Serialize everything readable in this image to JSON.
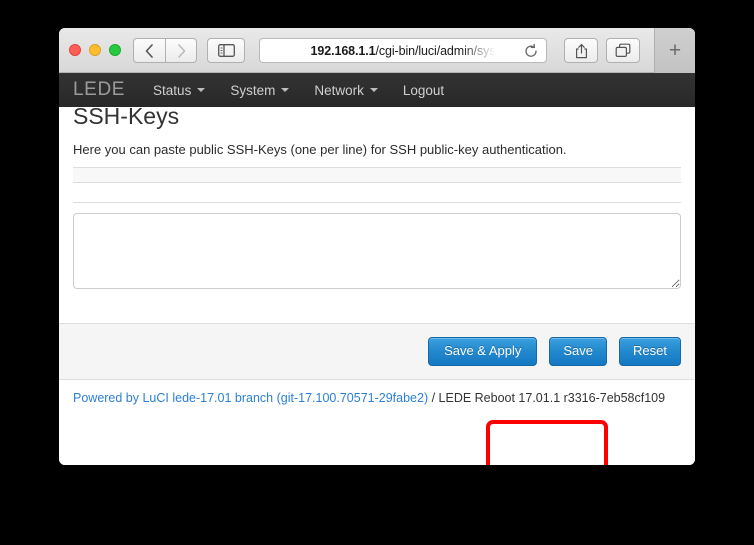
{
  "browser": {
    "url_host": "192.168.1.1",
    "url_path": "/cgi-bin/luci/admin/sys",
    "back_icon": "chevron-left-icon",
    "forward_icon": "chevron-right-icon",
    "sidebar_icon": "sidebar-icon",
    "reload_icon": "reload-icon",
    "share_icon": "share-icon",
    "tabs_icon": "tabs-icon",
    "new_tab_label": "+"
  },
  "luci": {
    "brand": "LEDE",
    "nav": [
      {
        "label": "Status",
        "has_caret": true
      },
      {
        "label": "System",
        "has_caret": true
      },
      {
        "label": "Network",
        "has_caret": true
      },
      {
        "label": "Logout",
        "has_caret": false
      }
    ],
    "page_title": "SSH-Keys",
    "page_description": "Here you can paste public SSH-Keys (one per line) for SSH public-key authentication.",
    "textarea": {
      "value": "",
      "placeholder": ""
    },
    "buttons": {
      "save_apply": "Save & Apply",
      "save": "Save",
      "reset": "Reset"
    },
    "footer": {
      "link_text": "Powered by LuCI lede-17.01 branch (git-17.100.70571-29fabe2)",
      "suffix_text": " / LEDE Reboot 17.01.1 r3316-7eb58cf109"
    }
  },
  "annotation": {
    "target": "Save & Apply",
    "color": "#ff0000"
  },
  "colors": {
    "accent_blue": "#2288cd",
    "navbar_dark": "#2e2e2e",
    "link_blue": "#2c80d8",
    "annotation_red": "#ff0000"
  }
}
